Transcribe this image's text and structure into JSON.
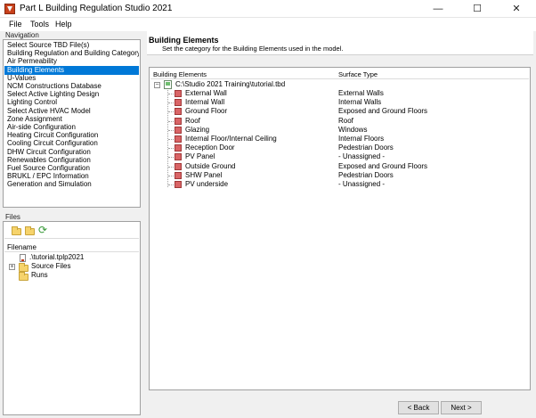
{
  "window": {
    "title": "Part L Building Regulation Studio 2021",
    "minimize_glyph": "—",
    "maximize_glyph": "☐",
    "close_glyph": "✕"
  },
  "menu": [
    "File",
    "Tools",
    "Help"
  ],
  "navigation": {
    "title": "Navigation",
    "selected_index": 3,
    "items": [
      "Select Source TBD File(s)",
      "Building Regulation and Building Category",
      "Air Permeability",
      "Building Elements",
      "U-Values",
      "NCM Constructions Database",
      "Select Active Lighting Design",
      "Lighting Control",
      "Select Active HVAC Model",
      "Zone Assignment",
      "Air-side Configuration",
      "Heating Circuit Configuration",
      "Cooling Circuit Configuration",
      "DHW Circuit Configuration",
      "Renewables Configuration",
      "Fuel Source Configuration",
      "BRUKL / EPC Information",
      "Generation and Simulation"
    ]
  },
  "files": {
    "title": "Files",
    "column_header": "Filename",
    "toolbar_icons": [
      "open-folder-icon",
      "new-folder-icon",
      "refresh-icon"
    ],
    "tree": [
      {
        "label": ".\\tutorial.tplp2021",
        "icon": "document-icon"
      },
      {
        "label": "Source Files",
        "icon": "folder-icon",
        "expander": "+"
      },
      {
        "label": "Runs",
        "icon": "folder-icon"
      }
    ]
  },
  "main": {
    "heading": "Building Elements",
    "subtitle": "Set the category for the Building Elements used in the model.",
    "columns": [
      "Building Elements",
      "Surface Type"
    ],
    "root": {
      "expander": "−",
      "label": "C:\\Studio 2021 Training\\tutorial.tbd"
    },
    "rows": [
      {
        "element": "External Wall",
        "surface": "External Walls"
      },
      {
        "element": "Internal Wall",
        "surface": "Internal Walls"
      },
      {
        "element": "Ground Floor",
        "surface": "Exposed and Ground Floors"
      },
      {
        "element": "Roof",
        "surface": "Roof"
      },
      {
        "element": "Glazing",
        "surface": "Windows"
      },
      {
        "element": "Internal Floor/Internal Ceiling",
        "surface": "Internal Floors"
      },
      {
        "element": "Reception Door",
        "surface": "Pedestrian Doors"
      },
      {
        "element": "PV Panel",
        "surface": "- Unassigned -"
      },
      {
        "element": "Outside Ground",
        "surface": "Exposed and Ground Floors"
      },
      {
        "element": "SHW Panel",
        "surface": "Pedestrian Doors"
      },
      {
        "element": "PV underside",
        "surface": "- Unassigned -"
      }
    ]
  },
  "footer": {
    "back_label": "< Back",
    "next_label": "Next >"
  },
  "colors": {
    "selection": "#0078d7",
    "element_icon": "#d96466",
    "folder": "#f6d36b"
  }
}
